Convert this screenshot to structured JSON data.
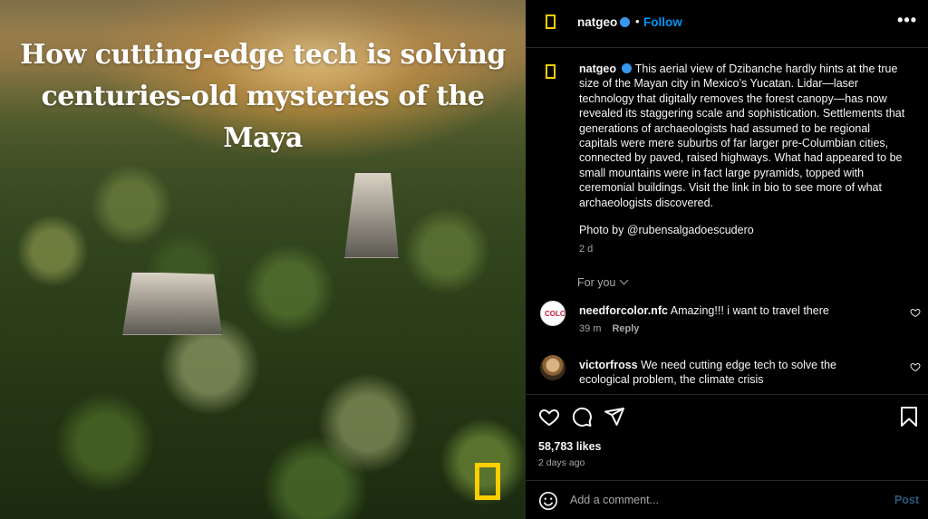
{
  "post": {
    "image": {
      "headline_line1": "How cutting-edge tech is solving",
      "headline_line2": "centuries-old mysteries of the Maya",
      "logo_icon": "natgeo-yellow-frame-icon"
    },
    "header": {
      "username": "natgeo",
      "separator": "•",
      "follow_label": "Follow",
      "more_label": "•••"
    },
    "caption": {
      "username": "natgeo",
      "text": "This aerial view of Dzibanche hardly hints at the true size of the Mayan city in Mexico’s Yucatan. Lidar—laser technology that digitally removes the forest canopy—has now revealed its staggering scale and sophistication. Settlements that generations of archaeologists had assumed to be regional capitals were mere suburbs of far larger pre-Columbian cities, connected by paved, raised highways. What had appeared to be small mountains were in fact large pyramids, topped with ceremonial buildings. Visit the link in bio to see more of what archaeologists discovered.",
      "photo_credit": "Photo by @rubensalgadoescudero",
      "age": "2 d"
    },
    "for_you_label": "For you",
    "comments": [
      {
        "username": "needforcolor.nfc",
        "avatar_text": "COLOR",
        "text": "Amazing!!! i want to travel there",
        "age": "39 m",
        "reply_label": "Reply"
      },
      {
        "username": "victorfross",
        "text": "We need cutting edge tech to solve the ecological problem, the climate crisis",
        "age": "",
        "reply_label": ""
      }
    ],
    "actions": {
      "likes": "58,783 likes",
      "date": "2 days ago"
    },
    "add_comment": {
      "placeholder": "Add a comment...",
      "post_label": "Post"
    },
    "colors": {
      "accent": "#0095f6",
      "natgeo_yellow": "#ffce00",
      "background": "#000000",
      "muted": "#a8a8a8"
    }
  }
}
